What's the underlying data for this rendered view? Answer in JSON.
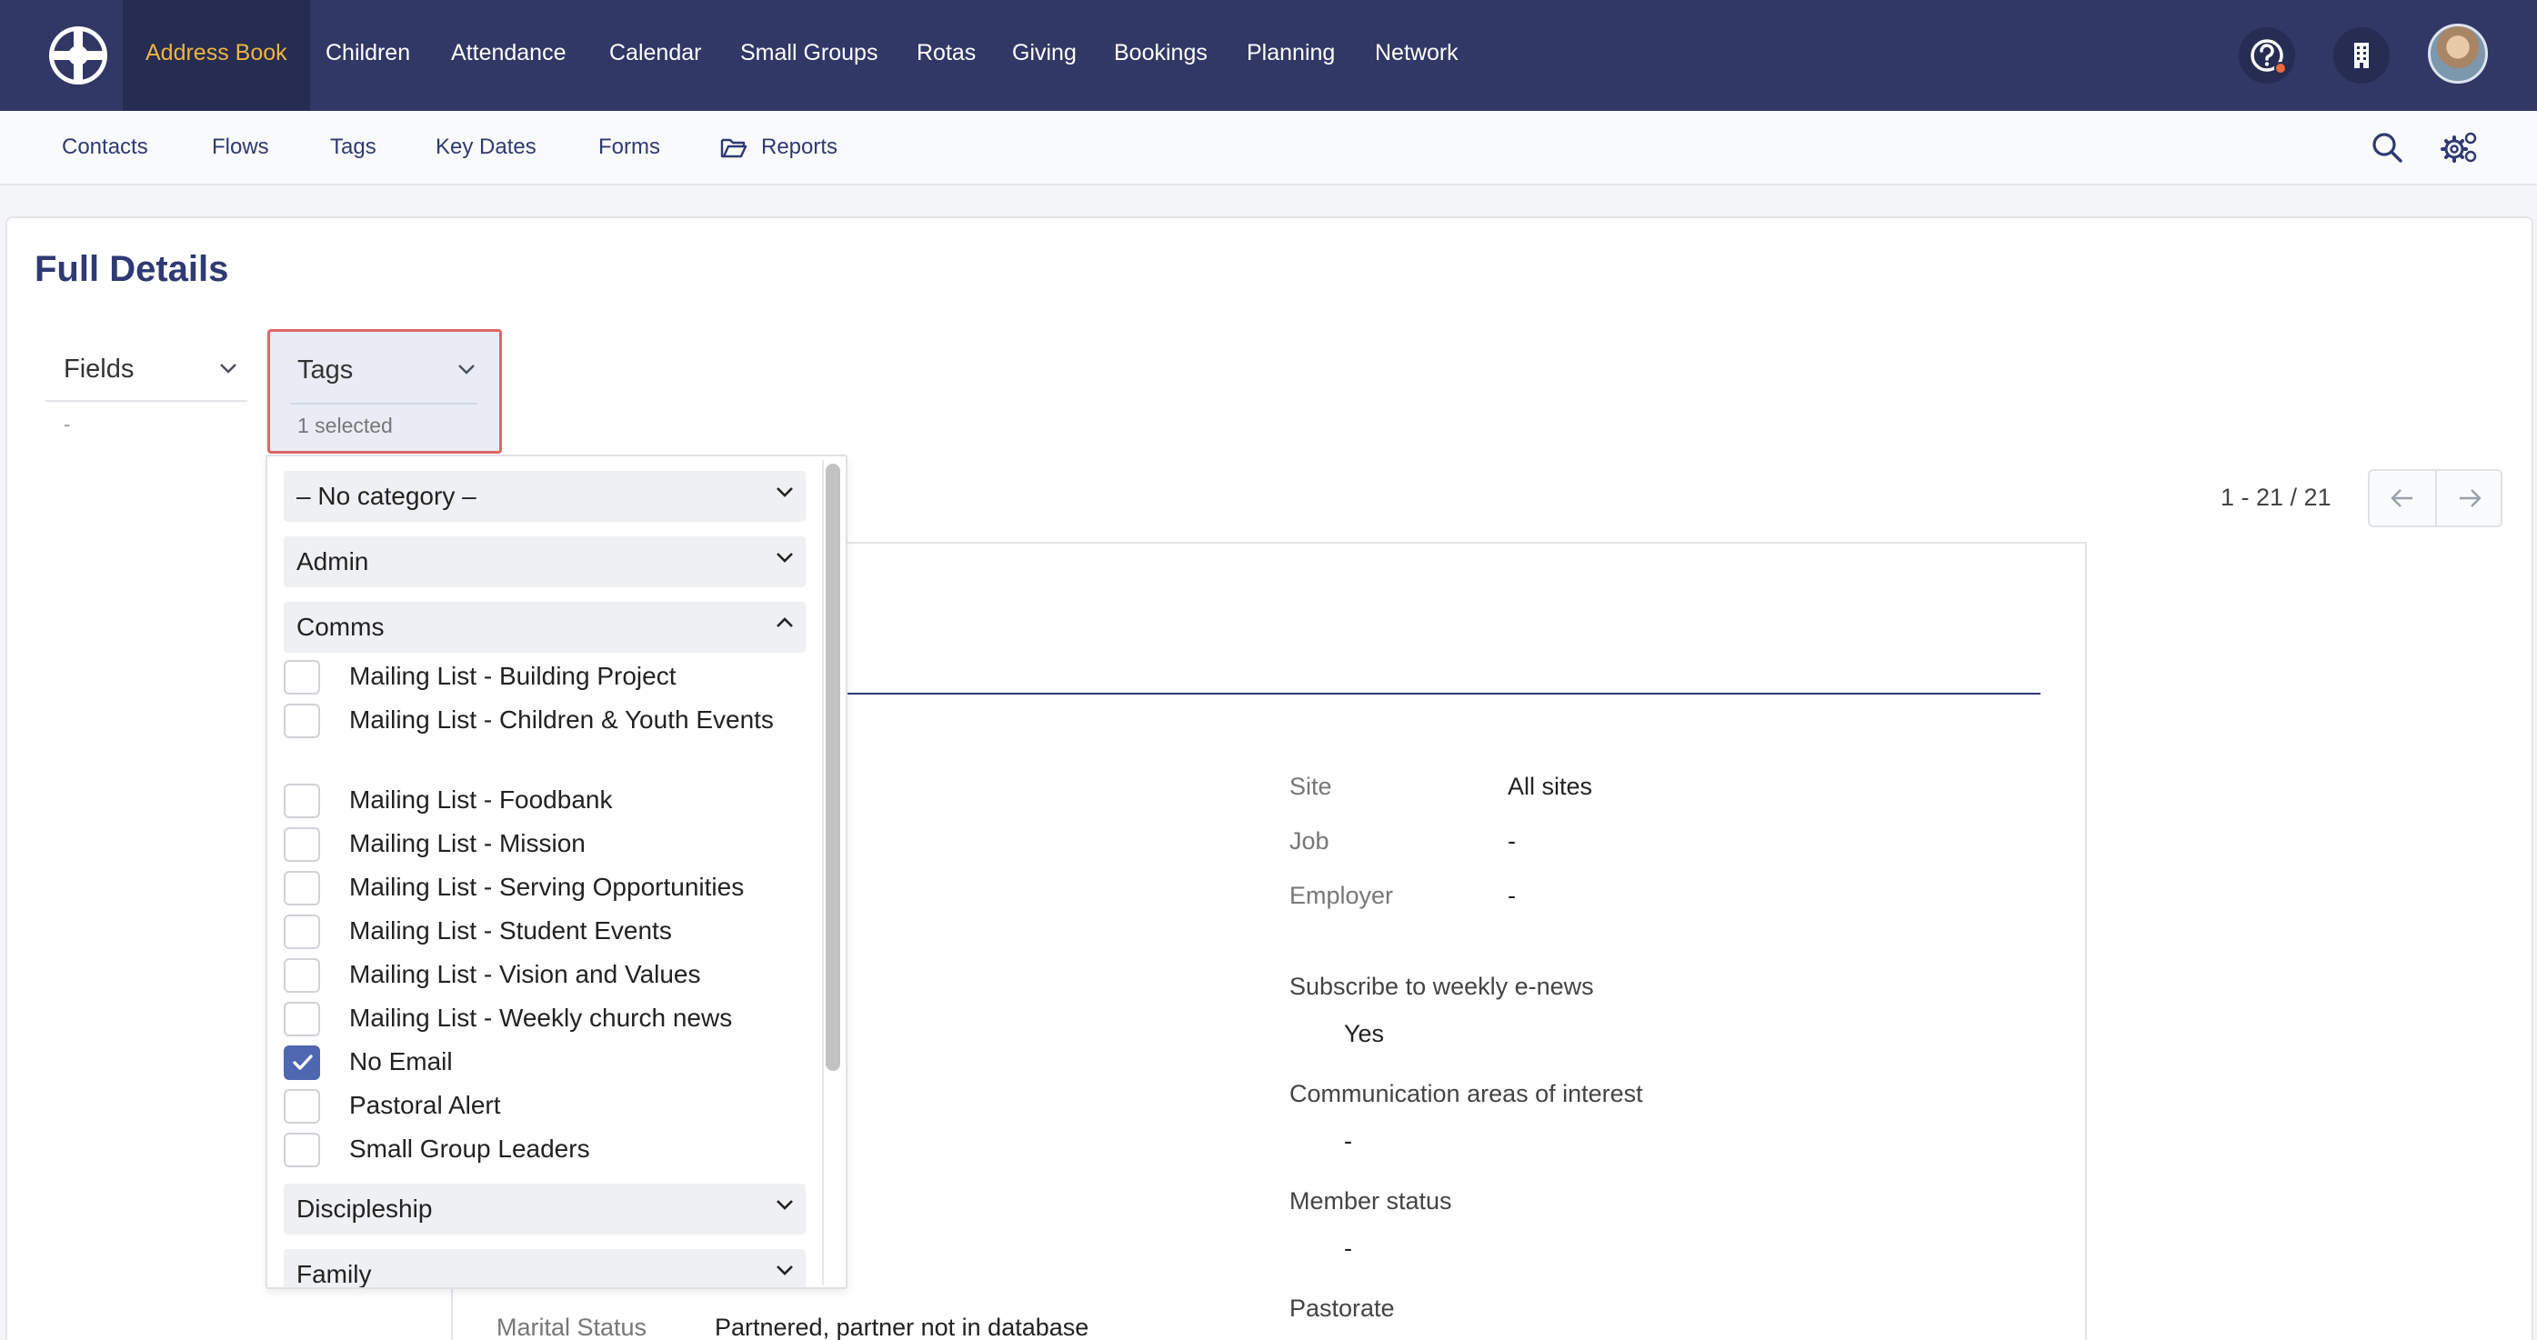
{
  "nav": {
    "items": [
      "Address Book",
      "Children",
      "Attendance",
      "Calendar",
      "Small Groups",
      "Rotas",
      "Giving",
      "Bookings",
      "Planning",
      "Network"
    ],
    "active": "Address Book",
    "active_color": "#f0b43c"
  },
  "top_icons": [
    "help-icon",
    "building-icon",
    "avatar"
  ],
  "subnav": {
    "items": [
      "Contacts",
      "Flows",
      "Tags",
      "Key Dates",
      "Forms",
      "Reports"
    ],
    "reports_icon": "folder-icon",
    "right_icons": [
      "search-icon",
      "settings-icon"
    ]
  },
  "page": {
    "title": "Full Details"
  },
  "filters": {
    "fields_label": "Fields",
    "fields_value": "-",
    "tags_label": "Tags",
    "tags_selected": "1 selected",
    "highlight_color": "#e06666"
  },
  "pagination": {
    "label": "1 - 21 / 21"
  },
  "tag_panel": {
    "categories": [
      {
        "label": "– No category –",
        "expanded": false
      },
      {
        "label": "Admin",
        "expanded": false
      },
      {
        "label": "Comms",
        "expanded": true
      },
      {
        "label": "Discipleship",
        "expanded": false
      },
      {
        "label": "Family",
        "expanded": false
      }
    ],
    "options": [
      {
        "label": "Mailing List - Building Project",
        "checked": false
      },
      {
        "label": "Mailing List - Children & Youth Events",
        "checked": false
      },
      {
        "label": "Mailing List - Foodbank",
        "checked": false
      },
      {
        "label": "Mailing List - Mission",
        "checked": false
      },
      {
        "label": "Mailing List - Serving Opportunities",
        "checked": false
      },
      {
        "label": "Mailing List - Student Events",
        "checked": false
      },
      {
        "label": "Mailing List - Vision and Values",
        "checked": false
      },
      {
        "label": "Mailing List - Weekly church news",
        "checked": false
      },
      {
        "label": "No Email",
        "checked": true
      },
      {
        "label": "Pastoral Alert",
        "checked": false
      },
      {
        "label": "Small Group Leaders",
        "checked": false
      }
    ],
    "check_color": "#4f67b0"
  },
  "details": {
    "site_label": "Site",
    "site_value": "All sites",
    "job_label": "Job",
    "job_value": "-",
    "employer_label": "Employer",
    "employer_value": "-",
    "enews_label": "Subscribe to weekly e-news",
    "enews_value": "Yes",
    "comms_label": "Communication areas of interest",
    "comms_value": "-",
    "member_label": "Member status",
    "member_value": "-",
    "pastorate_label": "Pastorate",
    "marital_label": "Marital Status",
    "marital_value": "Partnered, partner not in database"
  }
}
